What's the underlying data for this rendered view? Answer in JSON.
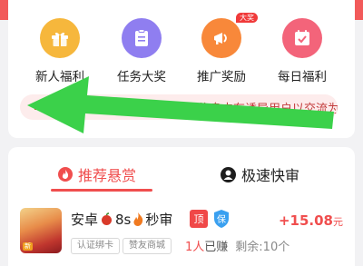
{
  "tiles": [
    {
      "label": "新人福利",
      "icon": "gift-icon"
    },
    {
      "label": "任务大奖",
      "icon": "clipboard-icon"
    },
    {
      "label": "推广奖励",
      "icon": "megaphone-icon",
      "badge": "大奖"
    },
    {
      "label": "每日福利",
      "icon": "calendar-check-icon"
    }
  ],
  "notice": {
    "text": "近期有用户反馈部分悬赏主信息中有诱导用户以交流为由添加私人联系方式后推荐其他项目",
    "icon": "speaker-icon"
  },
  "tabs": [
    {
      "label": "推荐悬赏",
      "icon": "flame-icon",
      "active": true
    },
    {
      "label": "极速快审",
      "icon": "person-icon",
      "active": false
    }
  ],
  "task": {
    "title_main": "安卓",
    "title_time": "8s",
    "title_suffix": "秒审",
    "badge_top": "顶",
    "badge_protect": "保",
    "thumb_tag": "新",
    "reward_amount": "+15.08",
    "reward_unit": "元",
    "tags": [
      "认证绑卡",
      "赞友商城"
    ],
    "earned_count": "1人",
    "earned_label": "已赚",
    "remaining": "剩余:10个"
  },
  "colors": {
    "accent": "#f04e4e",
    "arrow": "#3bd14a"
  }
}
